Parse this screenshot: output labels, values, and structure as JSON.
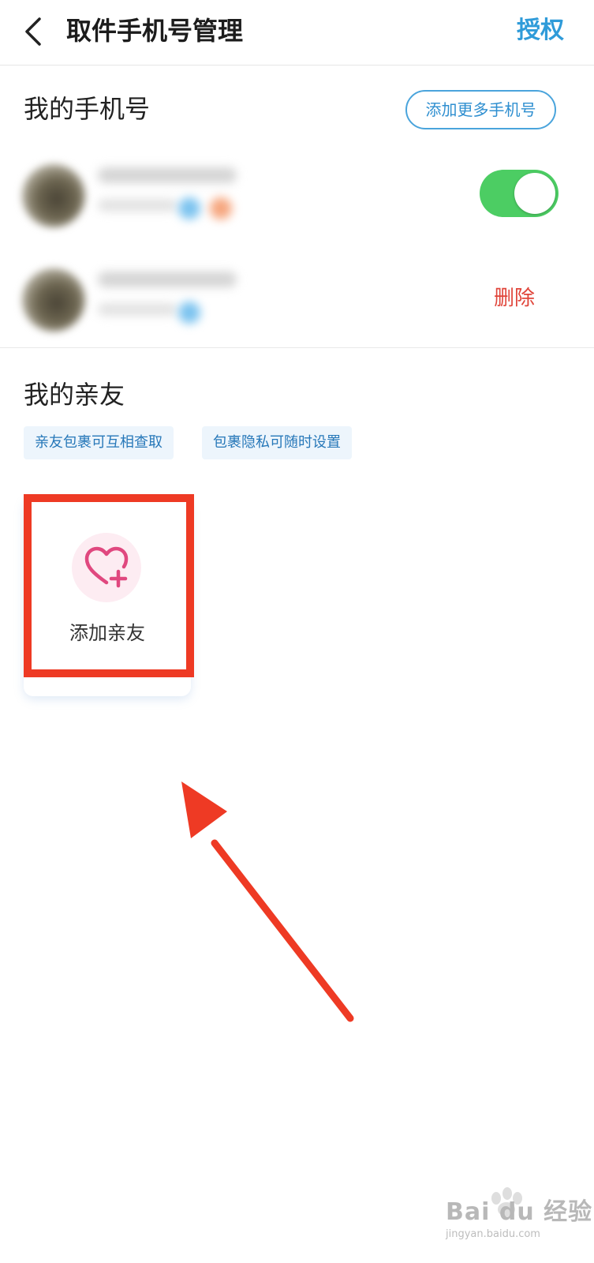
{
  "header": {
    "title": "取件手机号管理",
    "auth_label": "授权"
  },
  "my_phones": {
    "title": "我的手机号",
    "add_more_label": "添加更多手机号",
    "rows": [
      {
        "toggle_on": true
      },
      {
        "delete_label": "删除"
      }
    ]
  },
  "relatives": {
    "title": "我的亲友",
    "tags": [
      "亲友包裹可互相查取",
      "包裹隐私可随时设置"
    ],
    "add_label": "添加亲友"
  },
  "colors": {
    "accent_blue": "#2f9bd9",
    "toggle_green": "#4ccd63",
    "delete_red": "#e0453a",
    "heart_pink": "#e0487f",
    "annotation_red": "#ee3a24"
  },
  "icons": {
    "back": "chevron-left-icon",
    "add_relative": "heart-plus-icon",
    "annotation": "arrow-up-left-icon",
    "watermark": "baidu-paw-logo"
  },
  "watermark": {
    "text": "Bai du 经验",
    "sub": "jingyan.baidu.com"
  }
}
